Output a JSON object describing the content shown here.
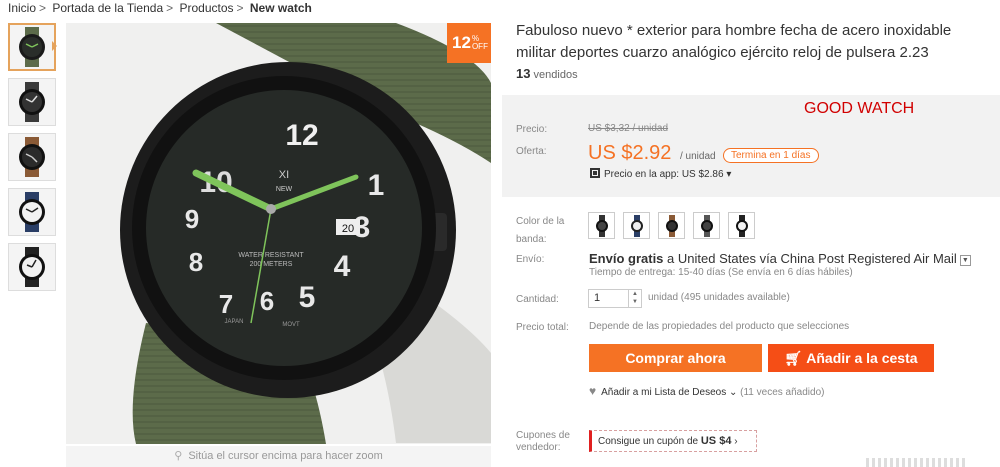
{
  "breadcrumb": {
    "items": [
      "Inicio",
      "Portada de la Tienda",
      "Productos"
    ],
    "separator": ">",
    "current": "New watch"
  },
  "gallery": {
    "discount_number": "12",
    "discount_percent": "%",
    "discount_off": "OFF",
    "zoom_hint": "Sitúa el cursor encima para hacer zoom",
    "thumbnails": [
      "green-black",
      "black-gray",
      "brown",
      "blue-white",
      "black-white"
    ]
  },
  "product": {
    "title": "Fabuloso nuevo * exterior para hombre fecha de acero inoxidable militar deportes cuarzo analógico ejército reloj de pulsera 2.23",
    "sold_count": "13",
    "sold_label": "vendidos"
  },
  "pricing": {
    "price_label": "Precio:",
    "original_price": "US $3,32 / unidad",
    "offer_label": "Oferta:",
    "offer_price": "US $2.92",
    "unit": "/ unidad",
    "timer": "Termina en 1 días",
    "app_price": "Precio en la app: US $2.86",
    "annotation": "GOOD WATCH"
  },
  "options": {
    "color_label_line1": "Color de la",
    "color_label_line2": "banda:",
    "colors": [
      "black",
      "blue",
      "brown",
      "gray",
      "white"
    ]
  },
  "shipping": {
    "label": "Envío:",
    "free_text": "Envío gratis",
    "to_text": "a",
    "destination": "United States vía China Post Registered Air Mail",
    "delivery_time": "Tiempo de entrega: 15-40 días (Se envía en 6 días hábiles)"
  },
  "quantity": {
    "label": "Cantidad:",
    "value": "1",
    "available": "unidad (495 unidades available)"
  },
  "total": {
    "label": "Precio total:",
    "note": "Depende de las propiedades del producto que selecciones"
  },
  "actions": {
    "buy_now": "Comprar ahora",
    "add_to_cart": "Añadir a la cesta",
    "wishlist": "Añadir a mi Lista de Deseos",
    "wishlist_count": "(11 veces añadido)"
  },
  "coupons": {
    "label_line1": "Cupones de",
    "label_line2": "vendedor:",
    "coupon_text": "Consigue un cupón de",
    "coupon_value": "US $4"
  },
  "watch_face": {
    "brand": "XI",
    "brand_sub": "NEW",
    "date": "20",
    "line1": "WATER RESISTANT",
    "line2": "200 METERS",
    "japan": "JAPAN",
    "movt": "MOVT"
  },
  "colors": {
    "accent": "#f57224",
    "cart": "#f54e16",
    "strap": "#5c6b4a",
    "lume": "#7fc45b"
  }
}
